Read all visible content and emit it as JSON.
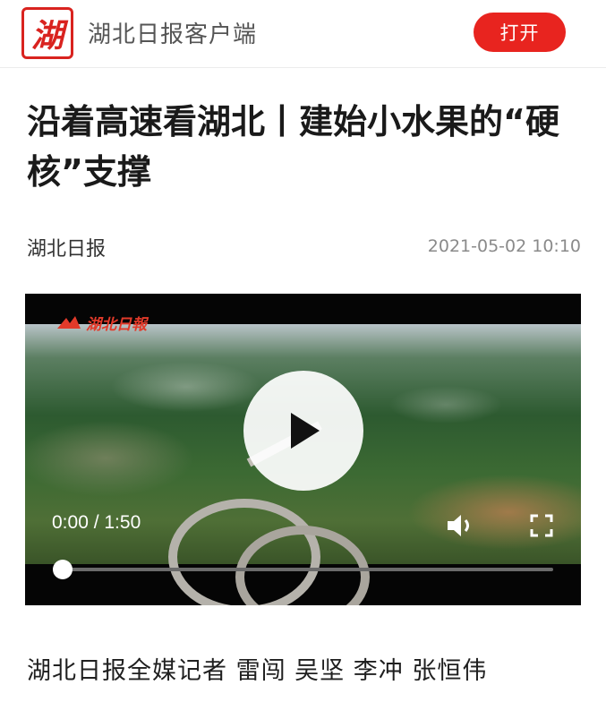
{
  "app_bar": {
    "logo_char": "湖",
    "app_name": "湖北日报客户端",
    "open_label": "打开",
    "accent": "#e8241f"
  },
  "article": {
    "title": "沿着高速看湖北丨建始小水果的“硬核”支撑",
    "source": "湖北日报",
    "date": "2021-05-02 10:10",
    "byline": "湖北日报全媒记者 雷闯 吴坚 李冲 张恒伟"
  },
  "video": {
    "logo_text": "湖北日報",
    "time": "0:00 / 1:50",
    "progress": 0,
    "icons": [
      "play-icon",
      "volume-icon",
      "fullscreen-icon"
    ]
  }
}
